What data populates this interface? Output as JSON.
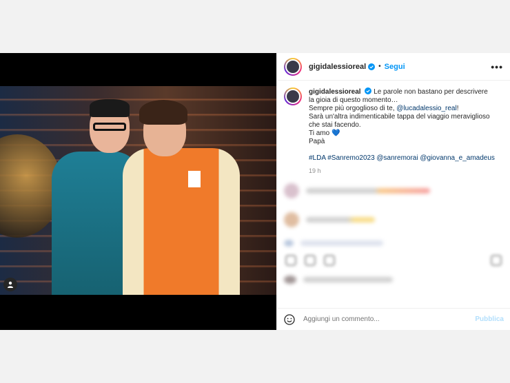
{
  "post": {
    "username": "gigidalessioreal",
    "follow_label": "Segui",
    "dot": "•",
    "more_label": "•••",
    "caption": {
      "username": "gigidalessioreal",
      "line1": "Le parole non bastano per descrivere la gioia di questo momento…",
      "line2_prefix": "Sempre più orgoglioso di te, ",
      "mention": "@lucadalessio_real",
      "line2_suffix": "!",
      "line3": "Sarà un'altra indimenticabile tappa del viaggio meraviglioso che stai facendo.",
      "line4": "Ti amo 💙",
      "line5": "Papà",
      "hashtags": "#LDA #Sanremo2023 @sanremorai @giovanna_e_amadeus",
      "time": "19 h"
    }
  },
  "comment_bar": {
    "placeholder": "Aggiungi un commento...",
    "publish_label": "Pubblica"
  },
  "colors": {
    "accent": "#0095f6",
    "link": "#00376b"
  },
  "icons": {
    "verified": "verified-badge-icon",
    "tag": "user-tag-icon",
    "emoji": "emoji-icon"
  }
}
